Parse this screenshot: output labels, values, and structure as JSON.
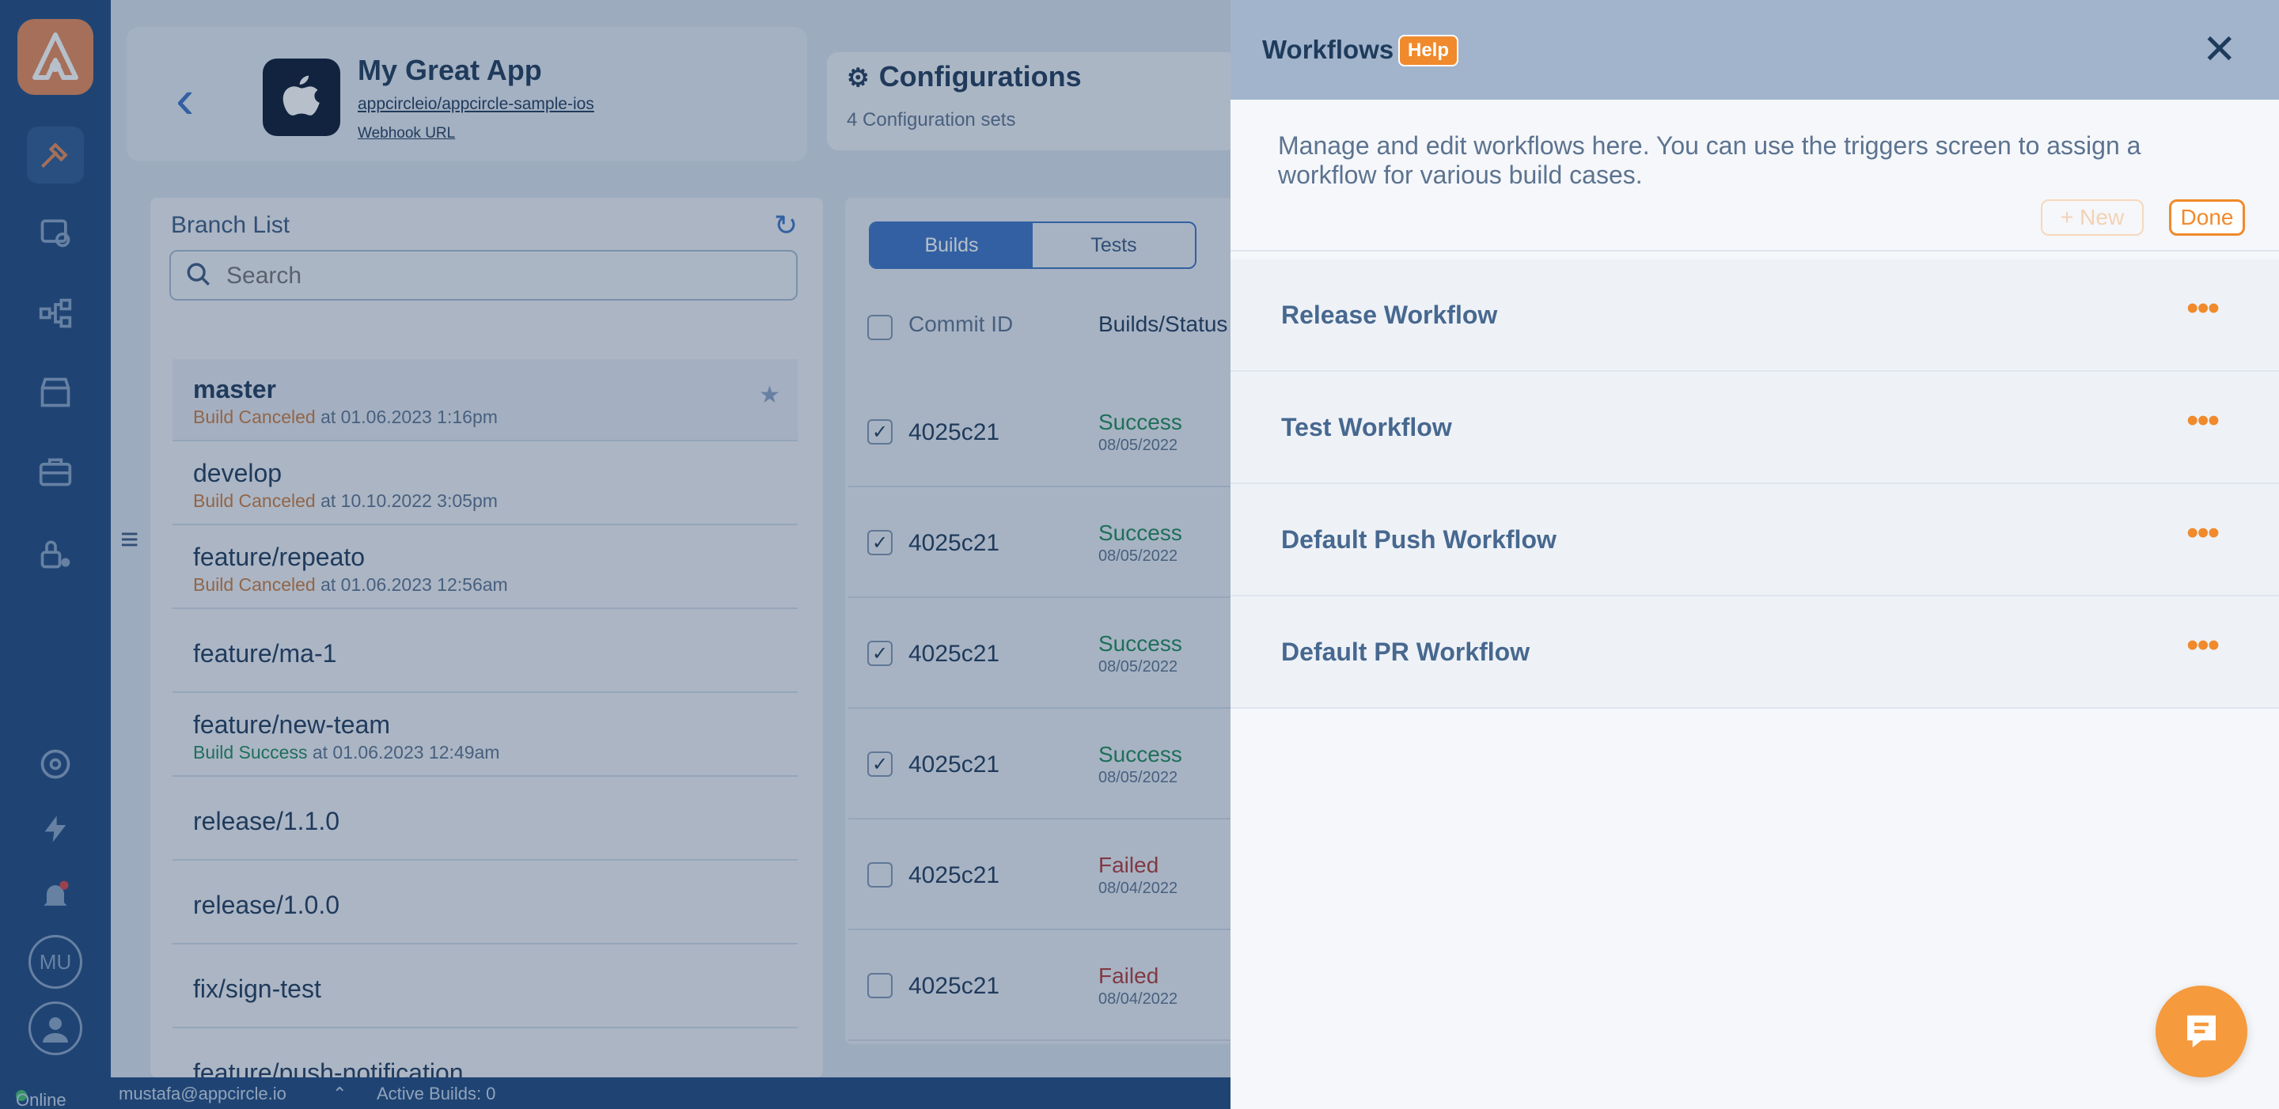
{
  "rail": {
    "icons": [
      "build-icon",
      "distribution-icon",
      "workflow-icon",
      "store-icon",
      "toolbox-icon",
      "lock-user-icon",
      "settings-icon",
      "bolt-icon",
      "notification-icon"
    ],
    "avatar_initials": "MU"
  },
  "app": {
    "name": "My Great App",
    "repo": "appcircleio/appcircle-sample-ios",
    "webhook": "Webhook URL"
  },
  "config": {
    "title": "Configurations",
    "subtitle": "4 Configuration sets"
  },
  "branch_panel": {
    "title": "Branch List",
    "search_placeholder": "Search",
    "branches": [
      {
        "name": "master",
        "status": "Build Canceled",
        "suffix": " at 01.06.2023 1:16pm",
        "status_type": "canceled"
      },
      {
        "name": "develop",
        "status": "Build Canceled",
        "suffix": " at 10.10.2022 3:05pm",
        "status_type": "canceled"
      },
      {
        "name": "feature/repeato",
        "status": "Build Canceled",
        "suffix": " at 01.06.2023 12:56am",
        "status_type": "canceled"
      },
      {
        "name": "feature/ma-1",
        "status": "",
        "suffix": "",
        "status_type": ""
      },
      {
        "name": "feature/new-team",
        "status": "Build Success",
        "suffix": " at 01.06.2023 12:49am",
        "status_type": "success"
      },
      {
        "name": "release/1.1.0",
        "status": "",
        "suffix": "",
        "status_type": ""
      },
      {
        "name": "release/1.0.0",
        "status": "",
        "suffix": "",
        "status_type": ""
      },
      {
        "name": "fix/sign-test",
        "status": "",
        "suffix": "",
        "status_type": ""
      },
      {
        "name": "feature/push-notification",
        "status": "",
        "suffix": "",
        "status_type": ""
      }
    ]
  },
  "builds_panel": {
    "tabs": [
      "Builds",
      "Tests"
    ],
    "col_commit": "Commit ID",
    "col_status": "Builds/Status",
    "rows": [
      {
        "checked": true,
        "commit": "4025c21",
        "status": "Success",
        "date": "08/05/2022"
      },
      {
        "checked": true,
        "commit": "4025c21",
        "status": "Success",
        "date": "08/05/2022"
      },
      {
        "checked": true,
        "commit": "4025c21",
        "status": "Success",
        "date": "08/05/2022"
      },
      {
        "checked": true,
        "commit": "4025c21",
        "status": "Success",
        "date": "08/05/2022"
      },
      {
        "checked": false,
        "commit": "4025c21",
        "status": "Failed",
        "date": "08/04/2022"
      },
      {
        "checked": false,
        "commit": "4025c21",
        "status": "Failed",
        "date": "08/04/2022"
      }
    ]
  },
  "statusbar": {
    "online": "Online",
    "user": "mustafa@appcircle.io",
    "active_builds": "Active Builds: 0"
  },
  "drawer": {
    "title": "Workflows",
    "help": "Help",
    "description": "Manage and edit workflows here. You can use the triggers screen to assign a workflow for various build cases.",
    "new_label": "New",
    "done_label": "Done",
    "workflows": [
      "Release Workflow",
      "Test Workflow",
      "Default Push Workflow",
      "Default PR Workflow"
    ]
  },
  "colors": {
    "accent": "#f08a2c",
    "rail": "#1f4a80",
    "primary": "#3b73c4",
    "success": "#1f8a5a",
    "failed": "#b03a3a",
    "canceled": "#c97b3f"
  }
}
